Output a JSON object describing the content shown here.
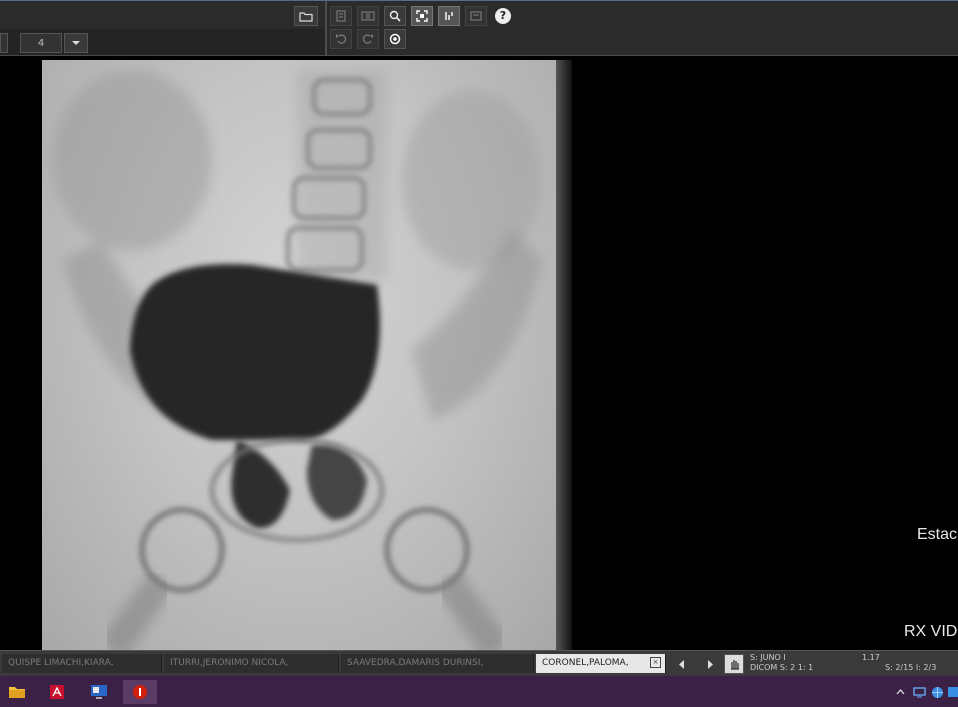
{
  "toolbar": {
    "zoom_field_value": "4",
    "help_label": "?"
  },
  "viewer": {
    "overlay_station": "Estac",
    "overlay_modality": "RX VID"
  },
  "patient_tabs": [
    {
      "label": "QUISPE LIMACHI,KIARA,",
      "active": false
    },
    {
      "label": "ITURRI,JERONIMO NICOLA,",
      "active": false
    },
    {
      "label": "SAAVEDRA,DAMARIS DURINSI,",
      "active": false
    },
    {
      "label": "CORONEL,PALOMA,",
      "active": true
    }
  ],
  "status": {
    "line1_left": "S: JUNO I",
    "line1_right": "1.17",
    "line2_left": "DICOM S: 2 1: 1",
    "line2_right": "S: 2/15  I: 2/3"
  },
  "colors": {
    "toolbar_bg": "#2b2b2b",
    "taskbar_bg": "#3b2146",
    "active_tab_bg": "#e8e8e8"
  }
}
